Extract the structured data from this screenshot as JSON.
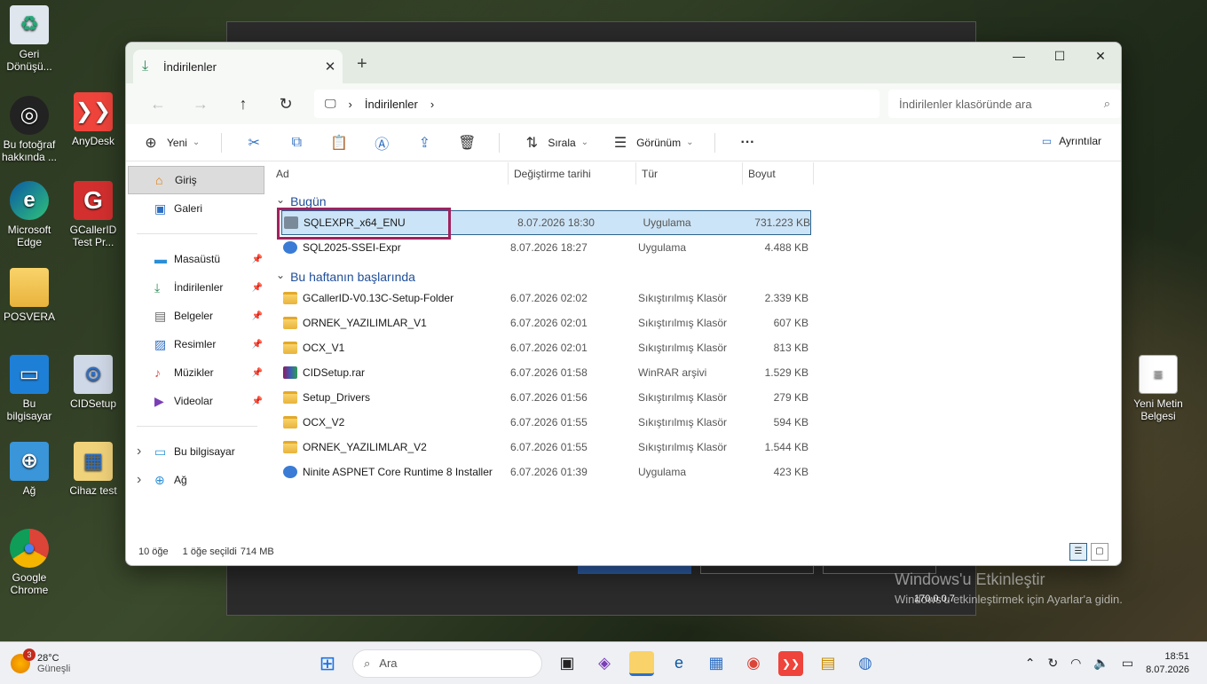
{
  "desktop": {
    "icons": [
      {
        "label": "Geri Dönüşü...",
        "icon": "recycle-bin"
      },
      {
        "label": "Bu fotoğraf hakkında ...",
        "icon": "camera"
      },
      {
        "label": "Microsoft Edge",
        "icon": "edge"
      },
      {
        "label": "POSVERA",
        "icon": "folder"
      },
      {
        "label": "Bu bilgisayar",
        "icon": "monitor"
      },
      {
        "label": "Ağ",
        "icon": "network"
      },
      {
        "label": "Google Chrome",
        "icon": "chrome"
      },
      {
        "label": "AnyDesk",
        "icon": "anydesk"
      },
      {
        "label": "GCallerID Test Pr...",
        "icon": "gcallerid"
      },
      {
        "label": "CIDSetup",
        "icon": "setup"
      },
      {
        "label": "Cihaz test",
        "icon": "setup"
      },
      {
        "label": "Yeni Metin Belgesi",
        "icon": "text-doc"
      }
    ],
    "watermark_title": "Windows'u Etkinleştir",
    "watermark_sub": "Windows'u etkinleştirmek için Ayarlar'a gidin.",
    "ip_text": "170.0.0.7"
  },
  "explorer": {
    "tab_title": "İndirilenler",
    "breadcrumb": "İndirilenler",
    "search_placeholder": "İndirilenler klasöründe ara",
    "toolbar": {
      "new_label": "Yeni",
      "sort_label": "Sırala",
      "view_label": "Görünüm",
      "details_label": "Ayrıntılar"
    },
    "sidebar": {
      "home": "Giriş",
      "gallery": "Galeri",
      "quick": [
        {
          "label": "Masaüstü"
        },
        {
          "label": "İndirilenler"
        },
        {
          "label": "Belgeler"
        },
        {
          "label": "Resimler"
        },
        {
          "label": "Müzikler"
        },
        {
          "label": "Videolar"
        }
      ],
      "this_pc": "Bu bilgisayar",
      "network": "Ağ"
    },
    "columns": {
      "name": "Ad",
      "date": "Değiştirme tarihi",
      "type": "Tür",
      "size": "Boyut"
    },
    "groups": [
      {
        "title": "Bugün",
        "rows": [
          {
            "name": "SQLEXPR_x64_ENU",
            "date": "8.07.2026 18:30",
            "type": "Uygulama",
            "size": "731.223 KB",
            "icon": "sql"
          },
          {
            "name": "SQL2025-SSEI-Expr",
            "date": "8.07.2026 18:27",
            "type": "Uygulama",
            "size": "4.488 KB",
            "icon": "app"
          }
        ]
      },
      {
        "title": "Bu haftanın başlarında",
        "rows": [
          {
            "name": "GCallerID-V0.13C-Setup-Folder",
            "date": "6.07.2026 02:02",
            "type": "Sıkıştırılmış Klasör",
            "size": "2.339 KB",
            "icon": "folder"
          },
          {
            "name": "ORNEK_YAZILIMLAR_V1",
            "date": "6.07.2026 02:01",
            "type": "Sıkıştırılmış Klasör",
            "size": "607 KB",
            "icon": "folder"
          },
          {
            "name": "OCX_V1",
            "date": "6.07.2026 02:01",
            "type": "Sıkıştırılmış Klasör",
            "size": "813 KB",
            "icon": "folder"
          },
          {
            "name": "CIDSetup.rar",
            "date": "6.07.2026 01:58",
            "type": "WinRAR arşivi",
            "size": "1.529 KB",
            "icon": "rar"
          },
          {
            "name": "Setup_Drivers",
            "date": "6.07.2026 01:56",
            "type": "Sıkıştırılmış Klasör",
            "size": "279 KB",
            "icon": "folder"
          },
          {
            "name": "OCX_V2",
            "date": "6.07.2026 01:55",
            "type": "Sıkıştırılmış Klasör",
            "size": "594 KB",
            "icon": "folder"
          },
          {
            "name": "ORNEK_YAZILIMLAR_V2",
            "date": "6.07.2026 01:55",
            "type": "Sıkıştırılmış Klasör",
            "size": "1.544 KB",
            "icon": "folder"
          },
          {
            "name": "Ninite ASPNET Core Runtime 8 Installer",
            "date": "6.07.2026 01:39",
            "type": "Uygulama",
            "size": "423 KB",
            "icon": "app"
          }
        ]
      }
    ],
    "status": {
      "count": "10 öğe",
      "selected": "1 öğe seçildi",
      "selected_size": "714 MB"
    }
  },
  "taskbar": {
    "weather_temp": "28°C",
    "weather_desc": "Güneşli",
    "weather_badge": "3",
    "search_label": "Ara",
    "time": "18:51",
    "date": "8.07.2026"
  }
}
